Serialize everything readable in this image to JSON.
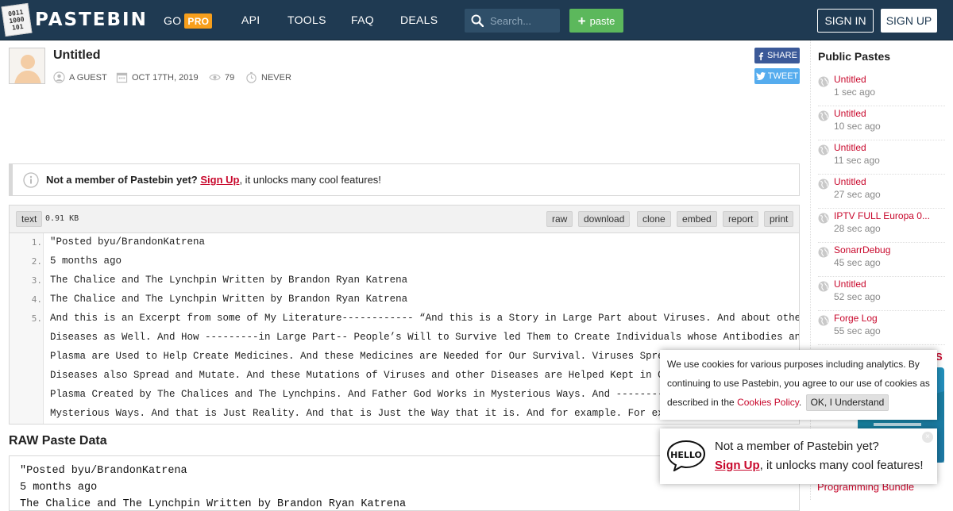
{
  "header": {
    "logo_text": "PASTEBIN",
    "logo_mark": [
      "0011",
      "1000",
      "101"
    ],
    "nav": [
      {
        "label": "GO",
        "badge": "PRO"
      },
      {
        "label": "API"
      },
      {
        "label": "TOOLS"
      },
      {
        "label": "FAQ"
      },
      {
        "label": "DEALS"
      }
    ],
    "search_placeholder": "Search...",
    "paste_button": "paste",
    "sign_in": "SIGN IN",
    "sign_up": "SIGN UP"
  },
  "paste": {
    "title": "Untitled",
    "author": "A GUEST",
    "date": "OCT 17TH, 2019",
    "views": "79",
    "expiry": "NEVER",
    "share_label": "SHARE",
    "tweet_label": "TWEET"
  },
  "notice": {
    "prefix": "Not a member of Pastebin yet?",
    "link": "Sign Up",
    "suffix": ", it unlocks many cool features!"
  },
  "code": {
    "format": "text",
    "size": "0.91 KB",
    "actions": [
      "raw",
      "download",
      "clone",
      "embed",
      "report",
      "print"
    ],
    "lines": [
      {
        "num": "1.",
        "text": "\"Posted byu/BrandonKatrena"
      },
      {
        "num": "2.",
        "text": "5 months ago"
      },
      {
        "num": "3.",
        "text": "The Chalice and The Lynchpin Written by Brandon Ryan Katrena"
      },
      {
        "num": "4.",
        "text": "The Chalice and The Lynchpin Written by Brandon Ryan Katrena"
      },
      {
        "num": "5.",
        "text": "And this is an Excerpt from some of My Literature------------ “And this is a Story in Large Part about Viruses. And about other"
      },
      {
        "num": "",
        "text": "Diseases as Well. And How ---------in Large Part-- People’s Will to Survive led Them to Create Individuals whose Antibodies and"
      },
      {
        "num": "",
        "text": "Plasma are Used to Help Create Medicines. And these Medicines are Needed for Our Survival. Viruses Spread and"
      },
      {
        "num": "",
        "text": "Diseases also Spread and Mutate. And these Mutations of Viruses and other Diseases are Helped Kept in Check by"
      },
      {
        "num": "",
        "text": "Plasma Created by The Chalices and The Lynchpins. And Father God Works in Mysterious Ways. And ---------yes--"
      },
      {
        "num": "",
        "text": "Mysterious Ways. And that is Just Reality. And that is Just the Way that it is. And for example. For example.”"
      }
    ]
  },
  "raw": {
    "title": "RAW Paste Data",
    "lines": [
      "\"Posted byu/BrandonKatrena",
      "5 months ago",
      "The Chalice and The Lynchpin Written by Brandon Ryan Katrena"
    ]
  },
  "sidebar": {
    "title": "Public Pastes",
    "items": [
      {
        "name": "Untitled",
        "time": "1 sec ago"
      },
      {
        "name": "Untitled",
        "time": "10 sec ago"
      },
      {
        "name": "Untitled",
        "time": "11 sec ago"
      },
      {
        "name": "Untitled",
        "time": "27 sec ago"
      },
      {
        "name": "IPTV FULL Europa 0...",
        "time": "28 sec ago"
      },
      {
        "name": "SonarrDebug",
        "time": "45 sec ago"
      },
      {
        "name": "Untitled",
        "time": "52 sec ago"
      },
      {
        "name": "Forge Log",
        "time": "55 sec ago"
      }
    ],
    "promo_link": "Programming Bundle",
    "promo_fragment": "S"
  },
  "cookie": {
    "text": "We use cookies for various purposes including analytics. By continuing to use Pastebin, you agree to our use of cookies as described in the",
    "link": "Cookies Policy",
    "punct": ".",
    "button": "OK, I Understand"
  },
  "hello_popup": {
    "bubble_text": "HELLO",
    "line1": "Not a member of Pastebin yet?",
    "link": "Sign Up",
    "suffix": ", it unlocks many cool features!",
    "close": "×"
  },
  "colors": {
    "header_bg": "#1f3a52",
    "pro_badge": "#f79f1c",
    "paste_button": "#5cb85c",
    "link_red": "#c8082c",
    "facebook": "#3b5998",
    "twitter": "#55acee"
  }
}
